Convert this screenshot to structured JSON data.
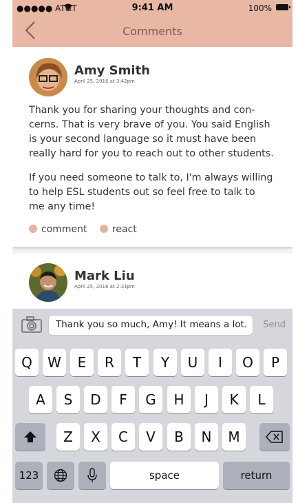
{
  "status": {
    "carrier": "●●●●● AT&T",
    "time": "9:41 AM",
    "battery": "100%"
  },
  "nav": {
    "title": "Comments"
  },
  "comments": [
    {
      "author": "Amy Smith",
      "date": "April 25, 2016 at 3:42pm",
      "paragraph1_lines": [
        "Thank you for sharing your thoughts and con-",
        "cerns. That is very brave of you. You said English",
        "is your second language so it must have been",
        "really hard for you to reach out to other students."
      ],
      "paragraph2_lines": [
        "If you need someone to talk to, I'm always willing",
        "to help ESL students out so feel free to talk to",
        "me any time!"
      ],
      "actions": [
        "comment",
        "react"
      ]
    },
    {
      "author": "Mark Liu",
      "date": "April 25, 2016 at 2:31pm"
    }
  ],
  "composer": {
    "value": "Thank you so much, Amy! It means a lot.",
    "send_label": "Send"
  },
  "keyboard": {
    "row1": [
      "Q",
      "W",
      "E",
      "R",
      "T",
      "Y",
      "U",
      "I",
      "O",
      "P"
    ],
    "row2": [
      "A",
      "S",
      "D",
      "F",
      "G",
      "H",
      "J",
      "K",
      "L"
    ],
    "row3": [
      "Z",
      "X",
      "C",
      "V",
      "B",
      "N",
      "M"
    ],
    "numbers_label": "123",
    "space_label": "space",
    "return_label": "return"
  },
  "colors": {
    "accent": "#e8b8a5",
    "dot": "#e5b39f"
  }
}
